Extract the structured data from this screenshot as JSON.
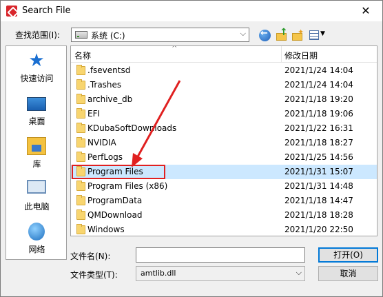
{
  "window": {
    "title": "Search File",
    "close_glyph": "✕"
  },
  "lookin": {
    "label": "查找范围(I):",
    "value": "系统 (C:)"
  },
  "sidebar": {
    "items": [
      {
        "label": "快速访问",
        "icon": "quick-access-star-icon"
      },
      {
        "label": "桌面",
        "icon": "desktop-icon"
      },
      {
        "label": "库",
        "icon": "library-icon"
      },
      {
        "label": "此电脑",
        "icon": "this-pc-icon"
      },
      {
        "label": "网络",
        "icon": "network-icon"
      }
    ]
  },
  "filelist": {
    "columns": {
      "name": "名称",
      "date": "修改日期"
    },
    "rows": [
      {
        "name": ".fseventsd",
        "date": "2021/1/24 14:04"
      },
      {
        "name": ".Trashes",
        "date": "2021/1/24 14:04"
      },
      {
        "name": "archive_db",
        "date": "2021/1/18 19:20"
      },
      {
        "name": "EFI",
        "date": "2021/1/18 19:06"
      },
      {
        "name": "KDubaSoftDownloads",
        "date": "2021/1/22 16:31"
      },
      {
        "name": "NVIDIA",
        "date": "2021/1/18 18:27"
      },
      {
        "name": "PerfLogs",
        "date": "2021/1/25 14:56"
      },
      {
        "name": "Program Files",
        "date": "2021/1/31 15:07"
      },
      {
        "name": "Program Files (x86)",
        "date": "2021/1/31 14:48"
      },
      {
        "name": "ProgramData",
        "date": "2021/1/18 14:47"
      },
      {
        "name": "QMDownload",
        "date": "2021/1/18 18:28"
      },
      {
        "name": "Windows",
        "date": "2021/1/20 22:50"
      }
    ],
    "selected_index": 7
  },
  "filename": {
    "label": "文件名(N):",
    "value": ""
  },
  "filetype": {
    "label": "文件类型(T):",
    "value": "amtlib.dll"
  },
  "buttons": {
    "open": "打开(O)",
    "cancel": "取消"
  },
  "colors": {
    "selection": "#cce8ff",
    "highlight_annotation": "#e02020",
    "accent": "#0078d7"
  }
}
